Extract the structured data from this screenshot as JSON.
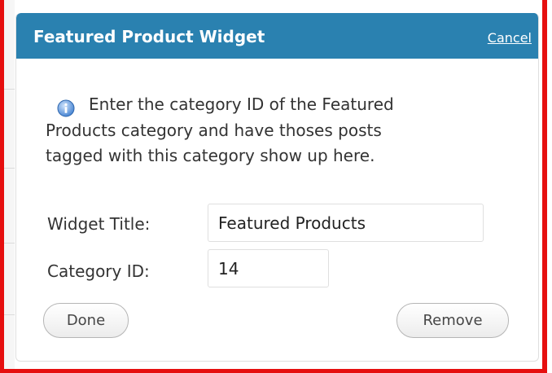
{
  "widget": {
    "title": "Featured Product Widget",
    "cancel_label": "Cancel"
  },
  "description": {
    "icon": "info-icon",
    "lines": [
      "Enter the category ID of the Featured",
      "Products category and have thoses posts",
      "tagged with this category show up here."
    ]
  },
  "form": {
    "title_label": "Widget Title:",
    "title_value": "Featured Products",
    "category_label": "Category ID:",
    "category_value": "14"
  },
  "buttons": {
    "done_label": "Done",
    "remove_label": "Remove"
  },
  "colors": {
    "header_bg": "#2a81b0",
    "frame_red": "#e60f0f"
  }
}
